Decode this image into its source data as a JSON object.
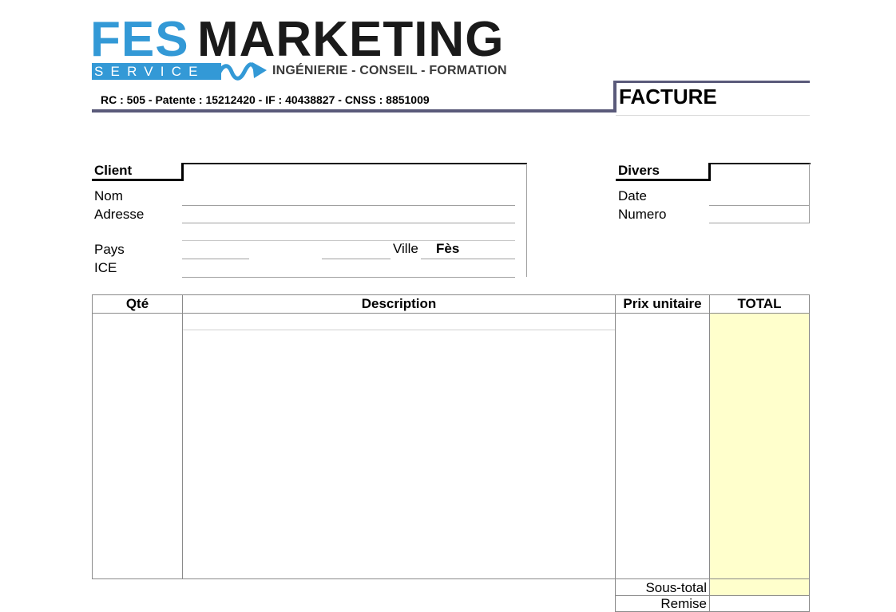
{
  "logo": {
    "fes": "FES",
    "marketing": "MARKETING",
    "service": "SERVICE",
    "tagline": "INGÉNIERIE - CONSEIL - FORMATION"
  },
  "header": {
    "legal": "RC : 505 - Patente : 15212420 - IF :  40438827  - CNSS : 8851009",
    "doc_title": "FACTURE"
  },
  "client": {
    "section_label": "Client",
    "nom_label": "Nom",
    "adresse_label": "Adresse",
    "pays_label": "Pays",
    "ville_label": "Ville",
    "ville_value": "Fès",
    "ice_label": "ICE"
  },
  "divers": {
    "section_label": "Divers",
    "date_label": "Date",
    "numero_label": "Numero"
  },
  "table": {
    "headers": [
      "Qté",
      "Description",
      "Prix unitaire",
      "TOTAL"
    ]
  },
  "footer": {
    "subtotal_label": "Sous-total",
    "remise_label": "Remise"
  },
  "colors": {
    "brand_blue": "#3399d6",
    "brand_dark": "#1a1a1a",
    "header_rule": "#5a5a7a",
    "total_column": "#ffffcc"
  }
}
